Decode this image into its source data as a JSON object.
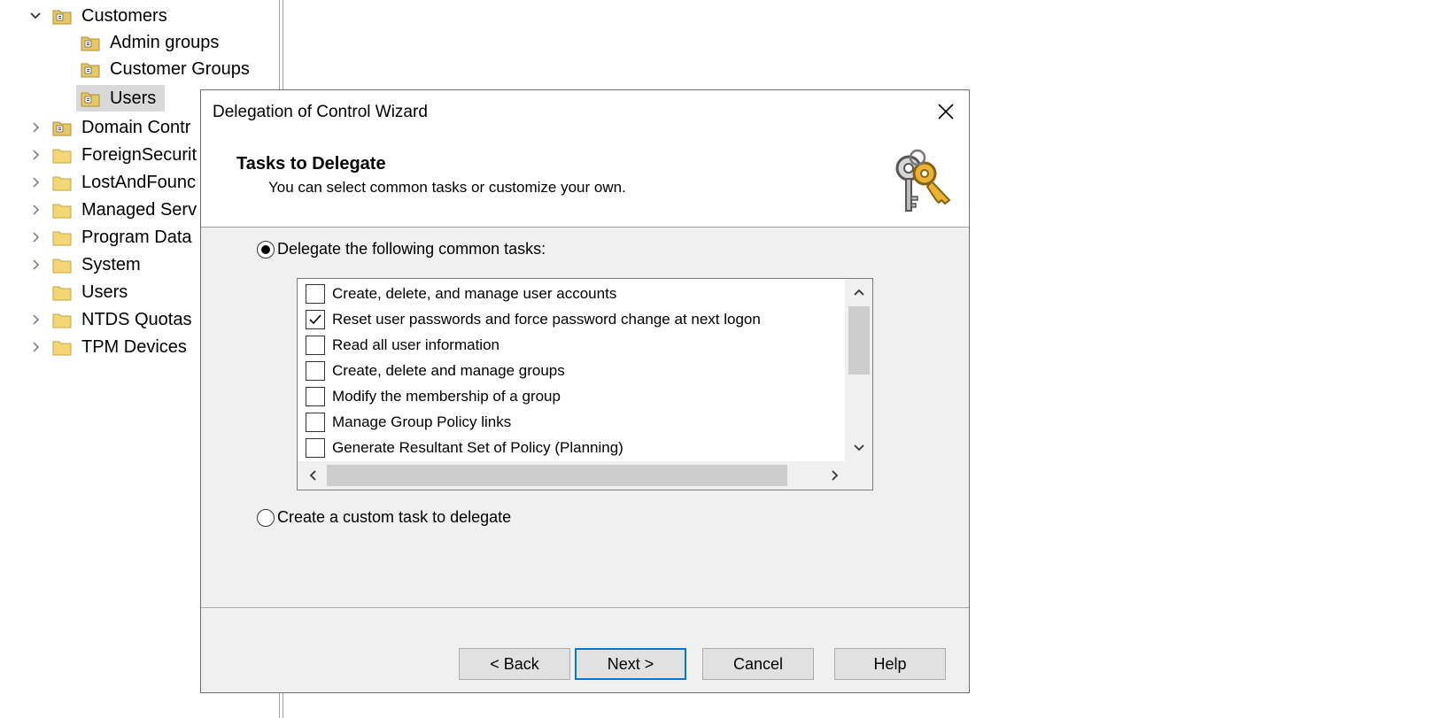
{
  "tree": {
    "customers": "Customers",
    "children": [
      "Admin groups",
      "Customer Groups",
      "Users"
    ],
    "items": [
      "Domain Contr",
      "ForeignSecurit",
      "LostAndFounc",
      "Managed Serv",
      "Program Data",
      "System",
      "Users",
      "NTDS Quotas",
      "TPM Devices"
    ]
  },
  "dialog": {
    "title": "Delegation of Control Wizard",
    "header_title": "Tasks to Delegate",
    "header_subtitle": "You can select common tasks or customize your own.",
    "radio_common": "Delegate the following common tasks:",
    "radio_custom": "Create a custom task to delegate",
    "tasks": [
      "Create, delete, and manage user accounts",
      "Reset user passwords and force password change at next logon",
      "Read all user information",
      "Create, delete and manage groups",
      "Modify the membership of a group",
      "Manage Group Policy links",
      "Generate Resultant Set of Policy (Planning)"
    ],
    "buttons": {
      "back": "< Back",
      "next": "Next >",
      "cancel": "Cancel",
      "help": "Help"
    }
  },
  "colors": {
    "accent": "#0078d7",
    "dialog_bg": "#f0f0f0",
    "selection": "#d9d9d9"
  }
}
